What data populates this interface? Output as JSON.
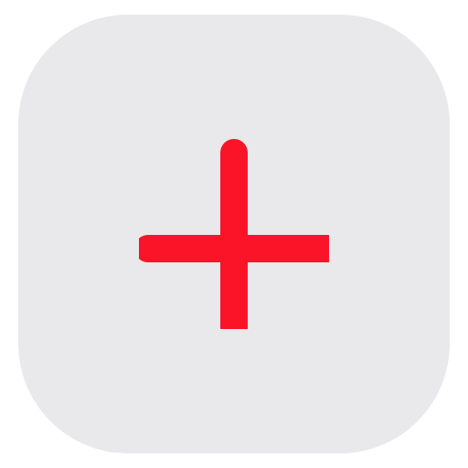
{
  "app_icon": {
    "icon_name": "plus-icon",
    "background_color": "#e9e9eb",
    "icon_color": "#fb1428"
  }
}
